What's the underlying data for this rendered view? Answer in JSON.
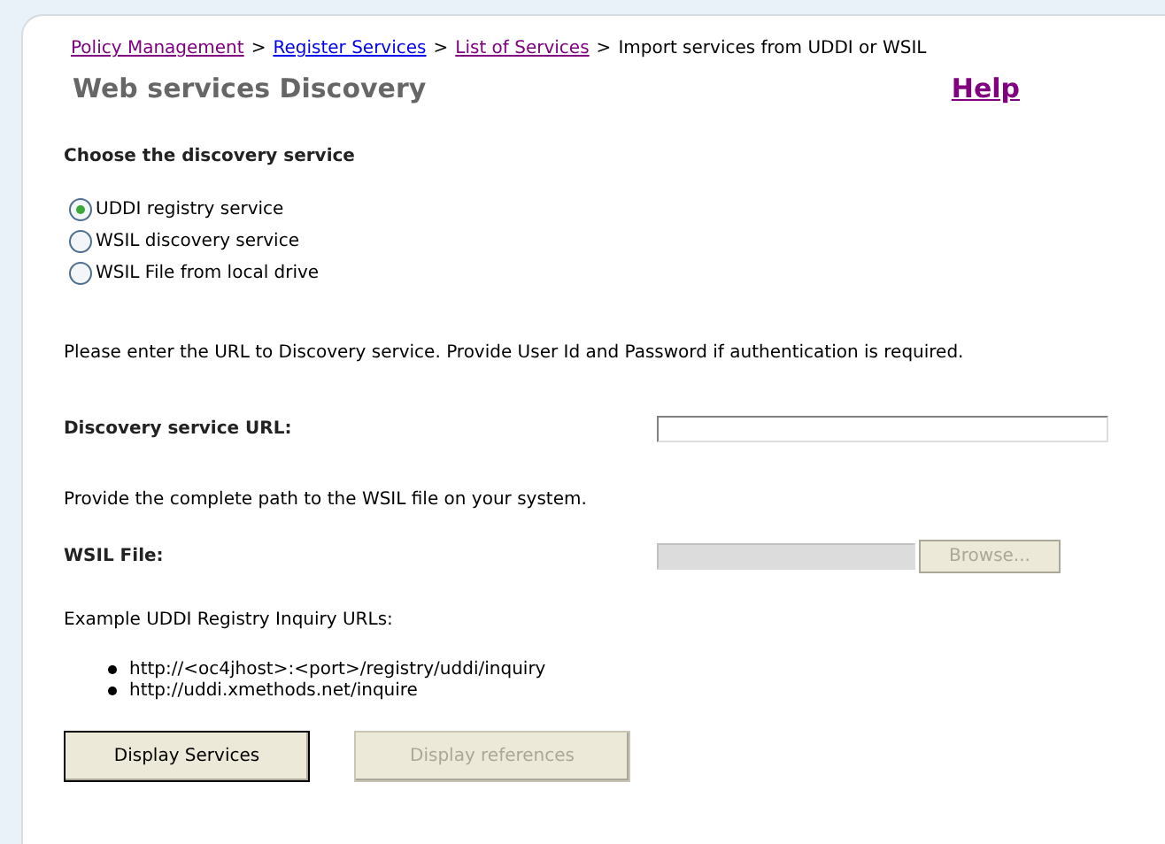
{
  "breadcrumb": [
    {
      "label": "Policy Management",
      "kind": "visited"
    },
    {
      "label": "Register Services",
      "kind": "link"
    },
    {
      "label": "List of Services",
      "kind": "visited"
    },
    {
      "label": "Import services from UDDI or WSIL",
      "kind": "current"
    }
  ],
  "breadcrumb_separator": ">",
  "title": "Web services Discovery",
  "help": "Help",
  "section_heading": "Choose the discovery service",
  "options": [
    {
      "label": "UDDI registry service",
      "selected": true
    },
    {
      "label": "WSIL discovery service",
      "selected": false
    },
    {
      "label": "WSIL File from local drive",
      "selected": false
    }
  ],
  "url_instructions": "Please enter the URL to Discovery service. Provide User Id and Password if authentication is required.",
  "url_field": {
    "label": "Discovery service URL:",
    "disabled": false
  },
  "path_instructions": "Provide the complete path to the WSIL file on your system.",
  "file_field": {
    "label": "WSIL File:",
    "disabled": true,
    "browse": "Browse..."
  },
  "examples_heading": "Example UDDI Registry Inquiry URLs:",
  "examples": [
    "http://<oc4jhost>:<port>/registry/uddi/inquiry",
    "http://uddi.xmethods.net/inquire"
  ],
  "buttons": [
    {
      "label": "Display Services",
      "disabled": false
    },
    {
      "label": "Display references",
      "disabled": true
    }
  ]
}
